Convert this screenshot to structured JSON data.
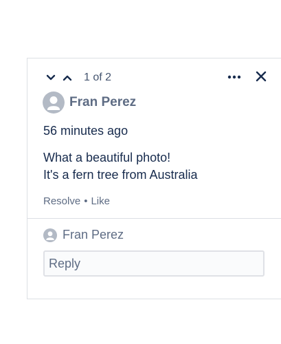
{
  "navigation": {
    "prev_icon": "chevron-down-icon",
    "next_icon": "chevron-up-icon",
    "counter": "1 of 2",
    "more_icon": "more-horizontal-icon",
    "close_icon": "close-icon"
  },
  "comment": {
    "author": "Fran Perez",
    "avatar_icon": "user-avatar-icon",
    "timestamp": "56 minutes ago",
    "body_line1": "What a beautiful photo!",
    "body_line2": "It's a fern tree from Australia",
    "resolve_label": "Resolve",
    "separator": "•",
    "like_label": "Like"
  },
  "reply": {
    "author": "Fran Perez",
    "avatar_icon": "user-avatar-icon",
    "placeholder": "Reply"
  },
  "colors": {
    "text_primary": "#172b4d",
    "text_subtle": "#5e6c84",
    "border": "#dcdfe4",
    "avatar_bg": "#dfe1e6"
  }
}
